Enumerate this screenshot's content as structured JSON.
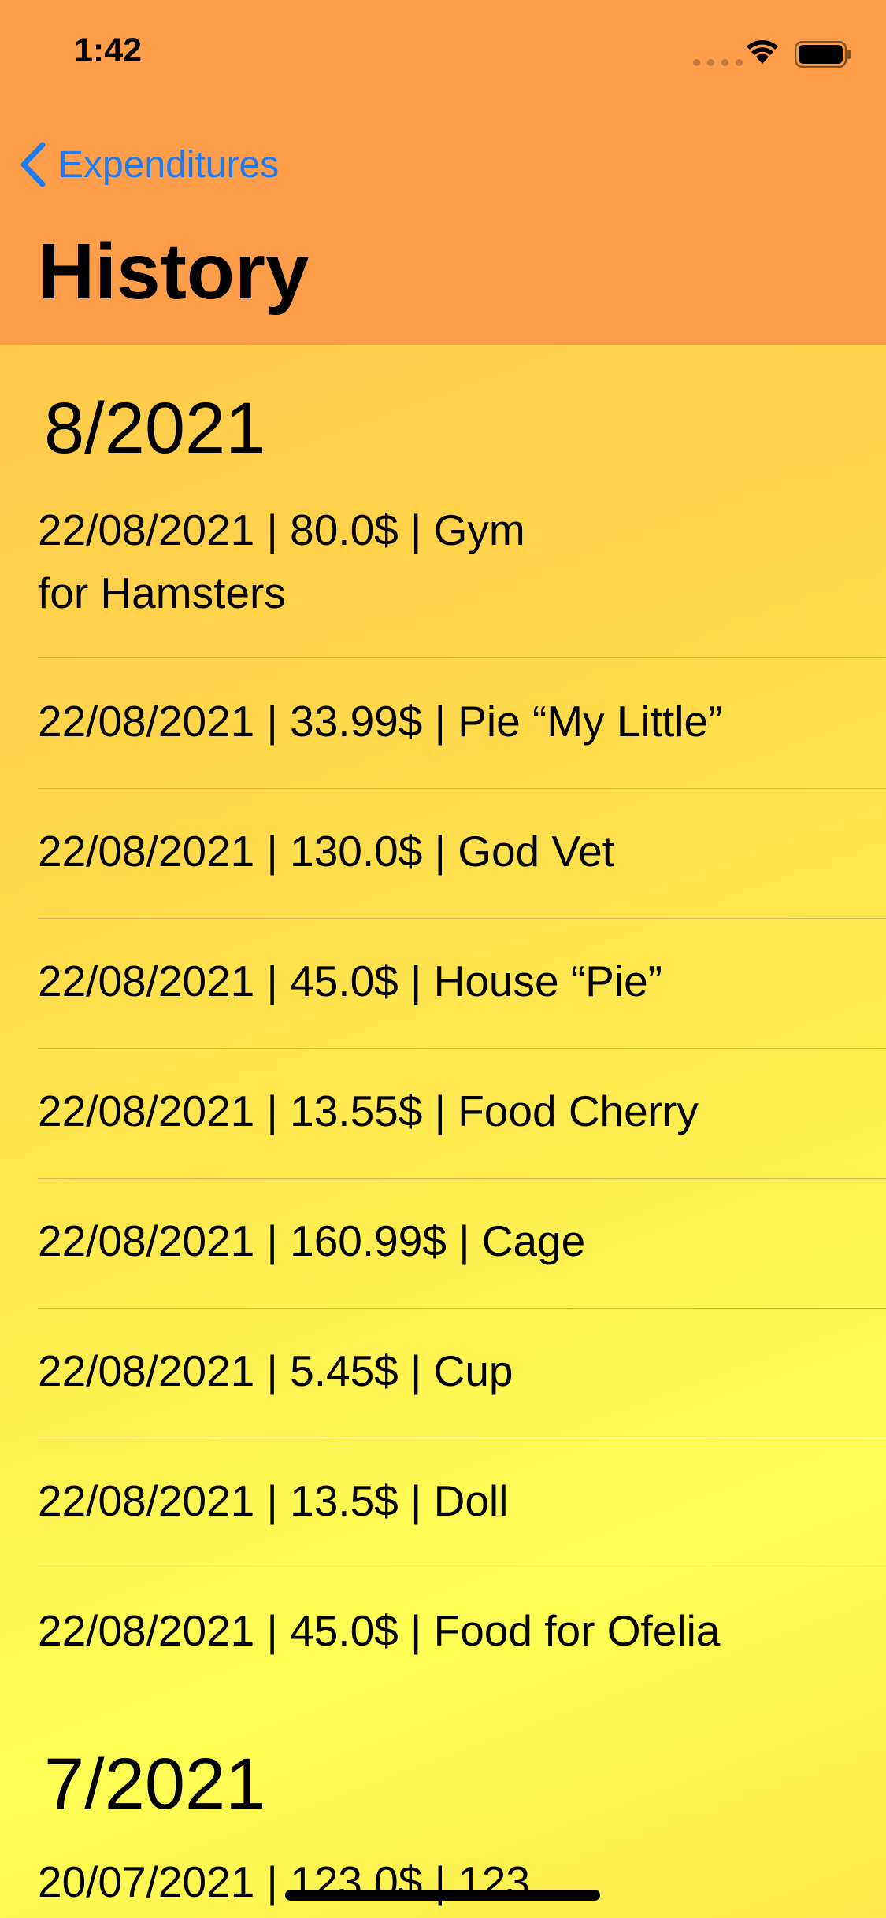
{
  "status_bar": {
    "time": "1:42"
  },
  "nav": {
    "back_label": "Expenditures",
    "title": "History"
  },
  "sections": [
    {
      "month": "8/2021",
      "entries": [
        {
          "line1": "22/08/2021 | 80.0$ | Gym",
          "line2": "for Hamsters"
        },
        {
          "line1": "22/08/2021 | 33.99$ | Pie “My Little”"
        },
        {
          "line1": "22/08/2021 | 130.0$ | God Vet"
        },
        {
          "line1": "22/08/2021 | 45.0$ | House “Pie”"
        },
        {
          "line1": "22/08/2021 | 13.55$ | Food Cherry"
        },
        {
          "line1": "22/08/2021 | 160.99$ | Cage"
        },
        {
          "line1": "22/08/2021 | 5.45$ | Cup"
        },
        {
          "line1": "22/08/2021 | 13.5$ | Doll"
        },
        {
          "line1": "22/08/2021 | 45.0$ | Food for Ofelia"
        }
      ]
    },
    {
      "month": "7/2021",
      "entries": [
        {
          "line1": "20/07/2021 | 123.0$ | 123"
        }
      ]
    }
  ],
  "colors": {
    "header": "#ff9e4a",
    "accent": "#1f7bf0"
  }
}
